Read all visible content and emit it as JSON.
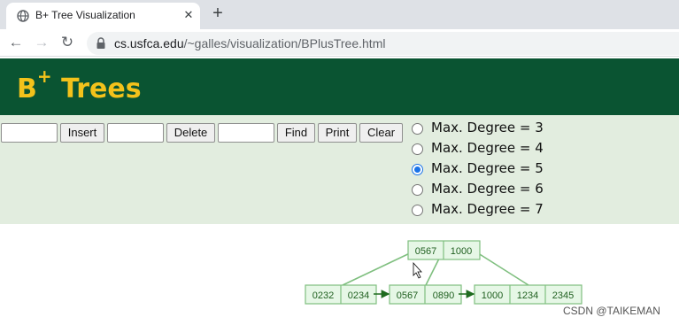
{
  "browser": {
    "tab_title": "B+ Tree Visualization",
    "tab_close": "✕",
    "new_tab": "+",
    "back": "←",
    "forward": "→",
    "reload": "↻",
    "url_host": "cs.usfca.edu",
    "url_path": "/~galles/visualization/BPlusTree.html"
  },
  "page": {
    "title": "B",
    "title_sup": "+",
    "title_rest": " Trees"
  },
  "controls": {
    "insert_value": "",
    "insert_label": "Insert",
    "delete_value": "",
    "delete_label": "Delete",
    "find_value": "",
    "find_label": "Find",
    "print_label": "Print",
    "clear_label": "Clear",
    "degrees": [
      {
        "label": "Max. Degree = 3",
        "checked": false
      },
      {
        "label": "Max. Degree = 4",
        "checked": false
      },
      {
        "label": "Max. Degree = 5",
        "checked": true
      },
      {
        "label": "Max. Degree = 6",
        "checked": false
      },
      {
        "label": "Max. Degree = 7",
        "checked": false
      }
    ]
  },
  "tree": {
    "root": [
      "0567",
      "1000"
    ],
    "leaves": [
      [
        "0232",
        "0234"
      ],
      [
        "0567",
        "0890"
      ],
      [
        "1000",
        "1234",
        "2345"
      ]
    ]
  },
  "watermark": "CSDN @TAIKEMAN"
}
